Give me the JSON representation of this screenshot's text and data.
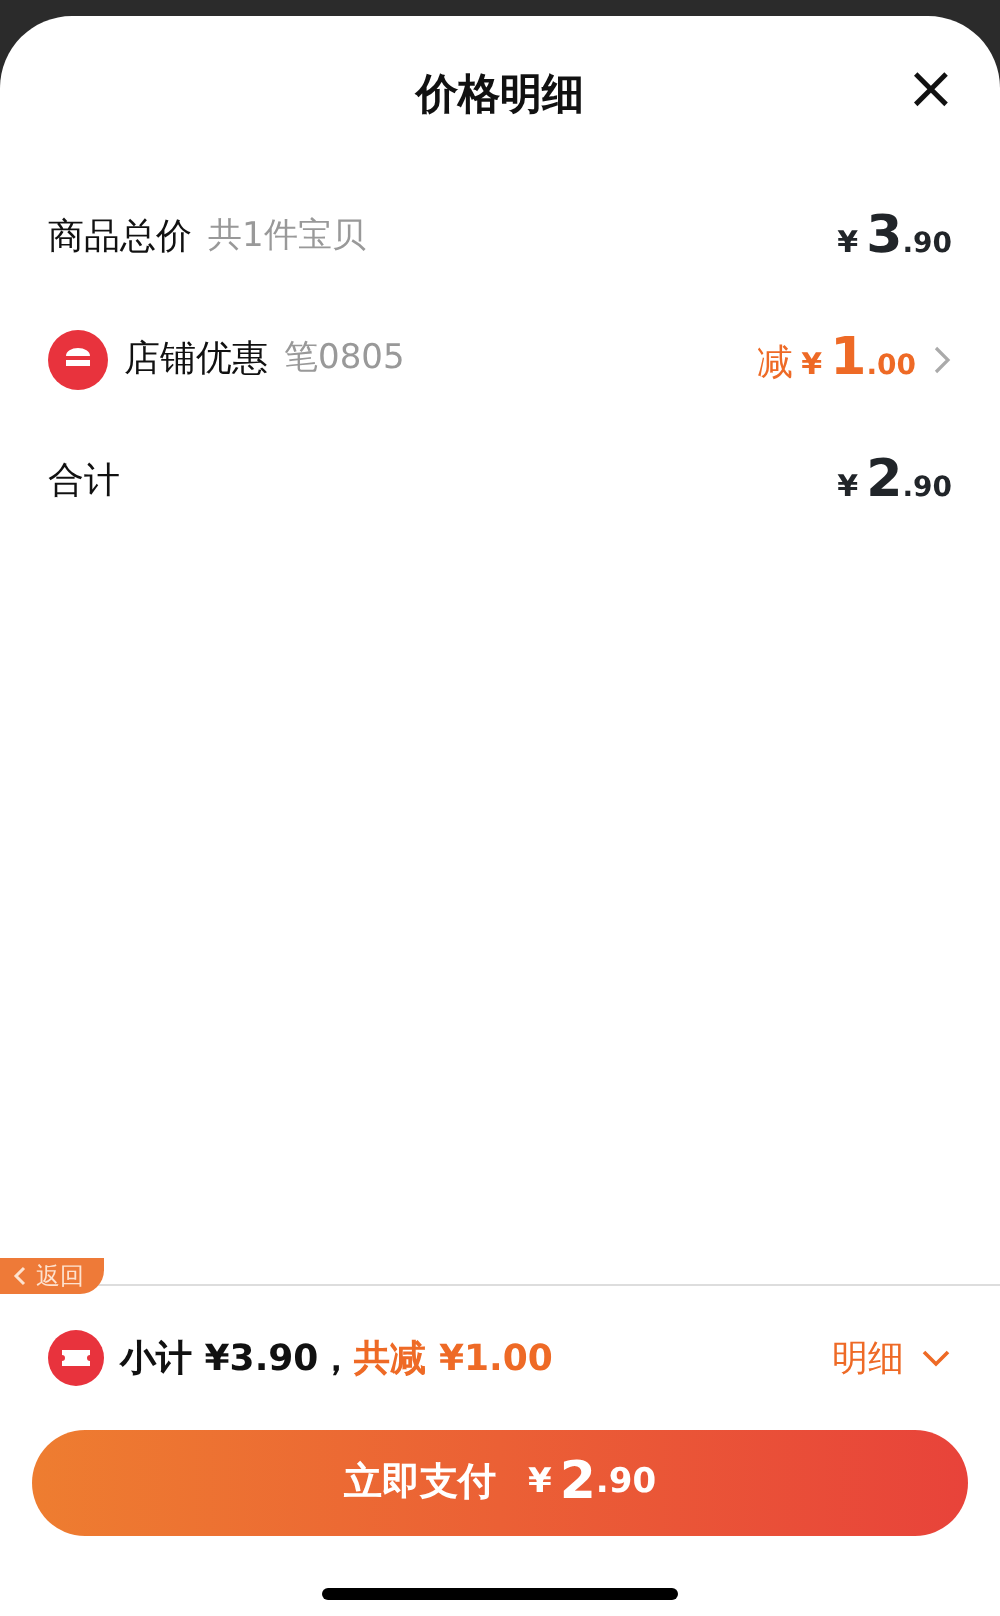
{
  "sheet": {
    "title": "价格明细",
    "close": "×"
  },
  "rows": [
    {
      "kind": "plain",
      "label": "商品总价",
      "note": "共1件宝贝",
      "amount": {
        "symbol": "¥",
        "integer": "3",
        "decimal": ".90"
      },
      "highlight": false,
      "chevron": false
    },
    {
      "kind": "shop",
      "label": "店铺优惠",
      "note": "笔0805",
      "amount": {
        "prefix": "减",
        "symbol": "¥",
        "integer": "1",
        "decimal": ".00"
      },
      "highlight": true,
      "chevron": true
    },
    {
      "kind": "plain",
      "label": "合计",
      "amount": {
        "symbol": "¥",
        "integer": "2",
        "decimal": ".90"
      },
      "highlight": false,
      "chevron": false
    }
  ],
  "back_tab": {
    "label": "返回"
  },
  "summary": {
    "subtotal": "小计 ¥3.90，",
    "discount": "共减 ¥1.00",
    "details": "明细",
    "expanded": false
  },
  "pay_button": {
    "label": "立即支付",
    "symbol": "¥",
    "integer": "2",
    "decimal": ".90"
  }
}
